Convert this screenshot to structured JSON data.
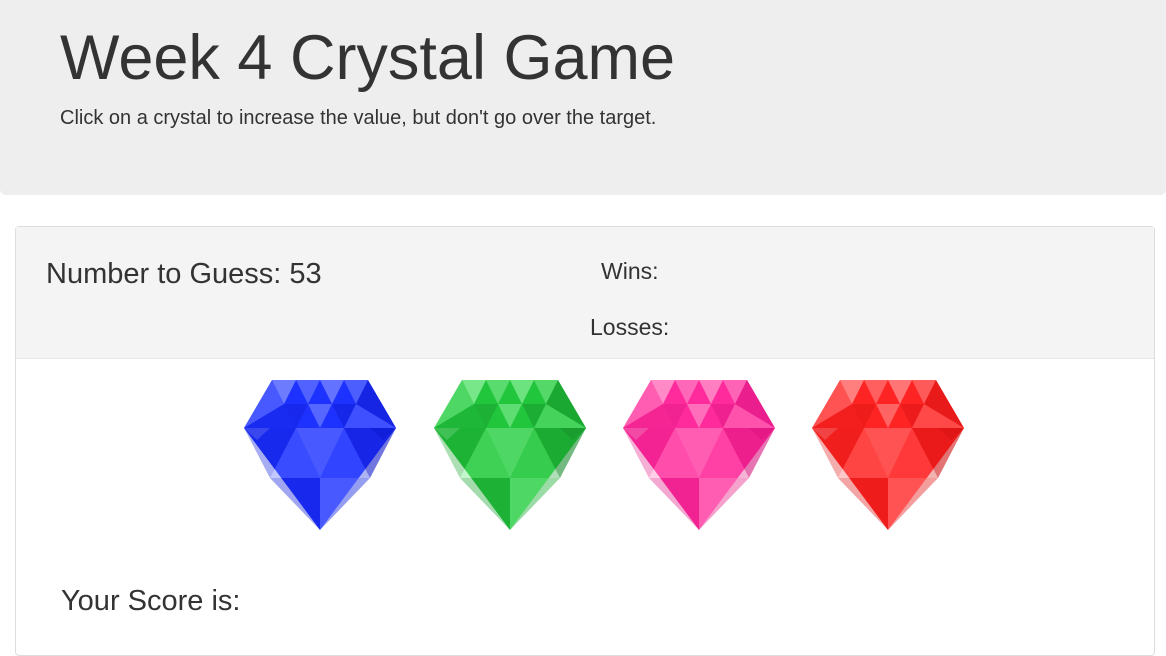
{
  "header": {
    "title": "Week 4 Crystal Game",
    "subtitle": "Click on a crystal to increase the value, but don't go over the target."
  },
  "panel": {
    "target_label": "Number to Guess: 53",
    "wins_label": "Wins:",
    "losses_label": "Losses:"
  },
  "crystals": [
    {
      "name": "blue-crystal",
      "icon": "blue-gem-icon",
      "base": "#1e32ff",
      "light": "#7b8aff",
      "dark": "#0d17c8"
    },
    {
      "name": "green-crystal",
      "icon": "green-gem-icon",
      "base": "#22c63c",
      "light": "#86ec96",
      "dark": "#138a27"
    },
    {
      "name": "pink-crystal",
      "icon": "pink-gem-icon",
      "base": "#ff2b9c",
      "light": "#ff9bcf",
      "dark": "#d6127d"
    },
    {
      "name": "red-crystal",
      "icon": "red-gem-icon",
      "base": "#ff2424",
      "light": "#ff8f8f",
      "dark": "#d10f0f"
    }
  ],
  "score": {
    "label": "Your Score is:"
  }
}
